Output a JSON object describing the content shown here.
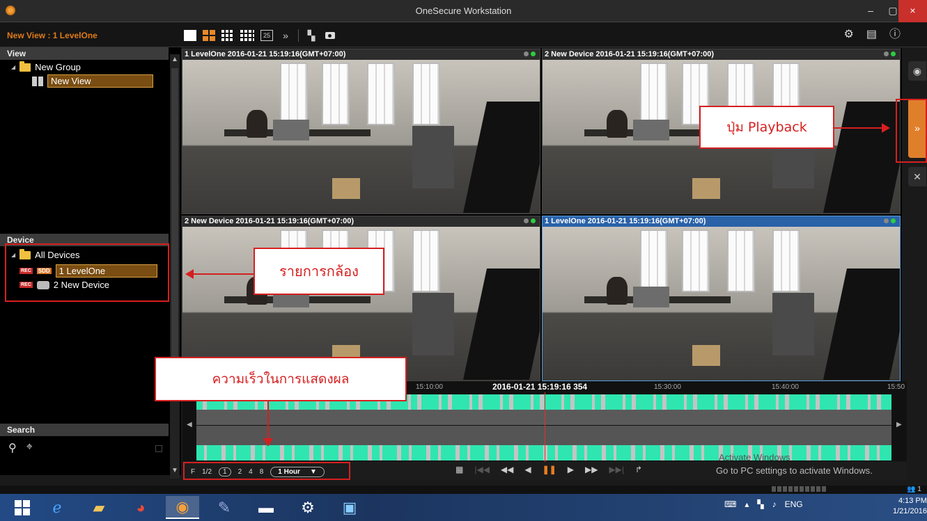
{
  "window": {
    "title": "OneSecure Workstation",
    "min": "–",
    "max": "▢",
    "close": "×"
  },
  "toolbar": {
    "view_name": "New View : 1 LevelOne",
    "layouts": [
      "1x1",
      "2x2",
      "3x3",
      "4x4",
      "25",
      "more"
    ],
    "layout_25_label": "25",
    "more_label": "»"
  },
  "left": {
    "view_header": "View",
    "group_label": "New Group",
    "view_item": "New View",
    "device_header": "Device",
    "all_devices": "All Devices",
    "devices": [
      {
        "name": "1 LevelOne",
        "rec": "REC",
        "badge": "SDD"
      },
      {
        "name": "2 New Device",
        "rec": "REC"
      }
    ],
    "search_header": "Search"
  },
  "tiles": [
    {
      "title": "1 LevelOne  2016-01-21 15:19:16(GMT+07:00)"
    },
    {
      "title": "2 New Device  2016-01-21 15:19:16(GMT+07:00)"
    },
    {
      "title": "2 New Device  2016-01-21 15:19:16(GMT+07:00)"
    },
    {
      "title": "1 LevelOne  2016-01-21 15:19:16(GMT+07:00)"
    }
  ],
  "timeline": {
    "ticks": [
      "15:10:00",
      "15:30:00",
      "15:40:00",
      "15:50"
    ],
    "current": "2016-01-21 15:19:16 354"
  },
  "controls": {
    "f_label": "F",
    "speeds": [
      "1/2",
      "1",
      "2",
      "4",
      "8"
    ],
    "range": "1 Hour"
  },
  "watermark": {
    "line1": "Activate Windows",
    "line2": "Go to PC settings to activate Windows."
  },
  "status": {
    "users": "1"
  },
  "annotations": {
    "playback": "ปุ่ม Playback",
    "camera_list": "รายการกล้อง",
    "speed": "ความเร็วในการแสดงผล"
  },
  "taskbar": {
    "lang": "ENG",
    "time": "4:13 PM",
    "date": "1/21/2016"
  },
  "colors": {
    "accent": "#e07a1a",
    "annotation": "#d61f1f",
    "recording": "#2fe6b0"
  }
}
